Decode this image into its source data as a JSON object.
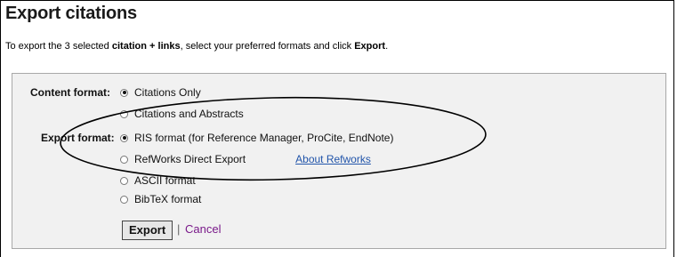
{
  "title": "Export citations",
  "intro": {
    "pre": "To export the 3 selected ",
    "bold1": "citation + links",
    "mid": ", select your preferred formats and click ",
    "bold2": "Export",
    "post": "."
  },
  "content_format": {
    "label": "Content format:",
    "options": [
      {
        "label": "Citations Only",
        "selected": true
      },
      {
        "label": "Citations and Abstracts",
        "selected": false
      }
    ]
  },
  "export_format": {
    "label": "Export format:",
    "options": [
      {
        "label": "RIS format (for Reference Manager, ProCite, EndNote)",
        "selected": true
      },
      {
        "label": "RefWorks Direct Export",
        "selected": false
      },
      {
        "label": "ASCII format",
        "selected": false
      },
      {
        "label": "BibTeX format",
        "selected": false
      }
    ],
    "refworks_link": "About Refworks"
  },
  "actions": {
    "export_label": "Export",
    "separator": "|",
    "cancel_label": "Cancel"
  }
}
